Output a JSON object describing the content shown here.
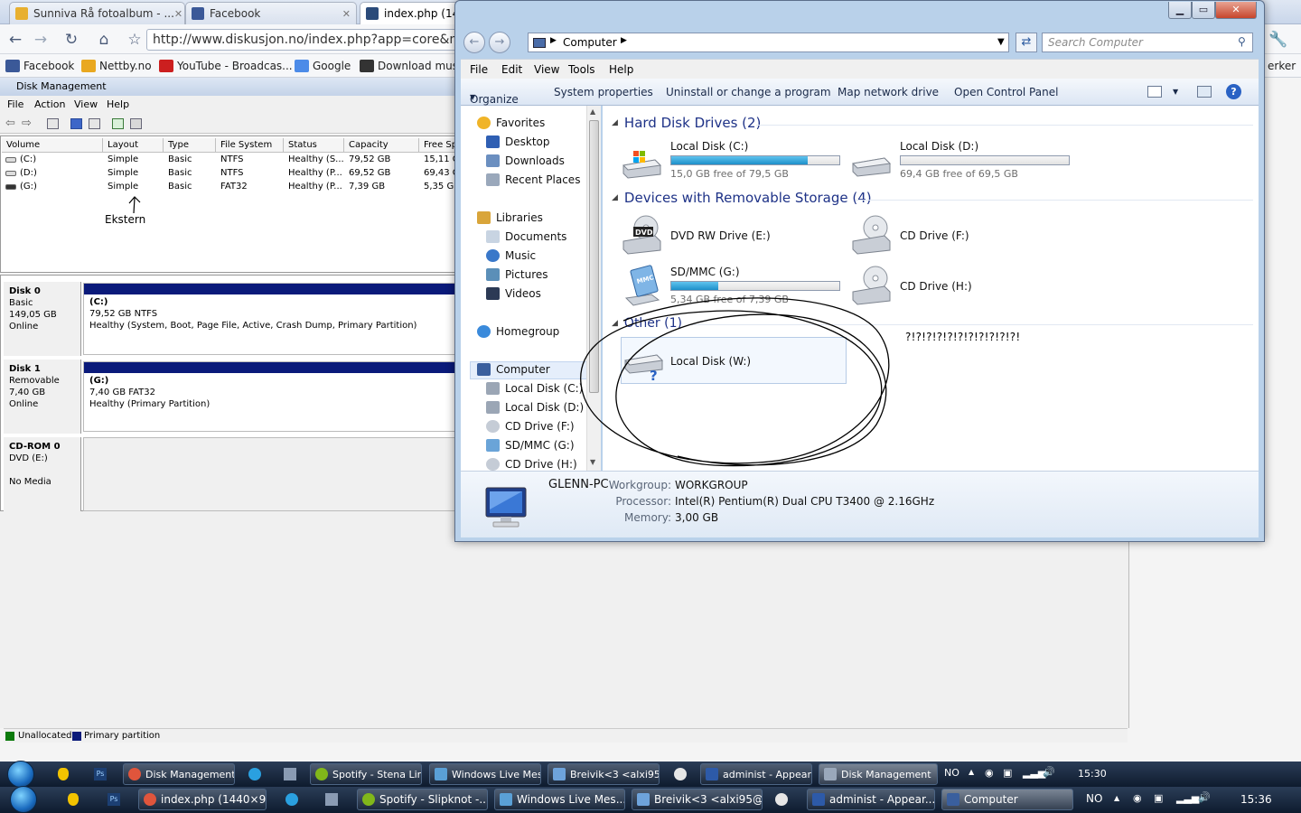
{
  "browser": {
    "tabs": [
      "Sunniva Rå fotoalbum - ...",
      "Facebook",
      "index.php (1440"
    ],
    "url": "http://www.diskusjon.no/index.php?app=core&mo",
    "bookmarks": [
      "Facebook",
      "Nettby.no",
      "YouTube - Broadcas...",
      "Google",
      "Download musi"
    ],
    "bookmarks_right": "erker"
  },
  "disk_management": {
    "title": "Disk Management",
    "menu": [
      "File",
      "Action",
      "View",
      "Help"
    ],
    "columns": [
      "Volume",
      "Layout",
      "Type",
      "File System",
      "Status",
      "Capacity",
      "Free Sp"
    ],
    "rows": [
      [
        "(C:)",
        "Simple",
        "Basic",
        "NTFS",
        "Healthy (S...",
        "79,52 GB",
        "15,11 G"
      ],
      [
        "(D:)",
        "Simple",
        "Basic",
        "NTFS",
        "Healthy (P...",
        "69,52 GB",
        "69,43 G"
      ],
      [
        "(G:)",
        "Simple",
        "Basic",
        "FAT32",
        "Healthy (P...",
        "7,39 GB",
        "5,35 GB"
      ]
    ],
    "annotation": "Ekstern",
    "disks": [
      {
        "name": "Disk 0",
        "l1": "Basic",
        "l2": "149,05 GB",
        "l3": "Online",
        "part_name": "(C:)",
        "part_size": "79,52 GB NTFS",
        "part_status": "Healthy (System, Boot, Page File, Active, Crash Dump, Primary Partition)"
      },
      {
        "name": "Disk 1",
        "l1": "Removable",
        "l2": "7,40 GB",
        "l3": "Online",
        "part_name": "(G:)",
        "part_size": "7,40 GB FAT32",
        "part_status": "Healthy (Primary Partition)"
      },
      {
        "name": "CD-ROM 0",
        "l1": "DVD (E:)",
        "l2": "",
        "l3": "No Media"
      }
    ],
    "legend": [
      "Unallocated",
      "Primary partition"
    ]
  },
  "explorer": {
    "breadcrumb": "Computer",
    "search_placeholder": "Search Computer",
    "menu": [
      "File",
      "Edit",
      "View",
      "Tools",
      "Help"
    ],
    "commands": [
      "Organize",
      "System properties",
      "Uninstall or change a program",
      "Map network drive",
      "Open Control Panel"
    ],
    "nav": {
      "favorites": "Favorites",
      "fav_items": [
        "Desktop",
        "Downloads",
        "Recent Places"
      ],
      "libraries": "Libraries",
      "lib_items": [
        "Documents",
        "Music",
        "Pictures",
        "Videos"
      ],
      "homegroup": "Homegroup",
      "computer": "Computer",
      "comp_items": [
        "Local Disk (C:)",
        "Local Disk (D:)",
        "CD Drive (F:)",
        "SD/MMC (G:)",
        "CD Drive (H:)"
      ]
    },
    "groups": {
      "hdd": "Hard Disk Drives (2)",
      "removable": "Devices with Removable Storage (4)",
      "other": "Other (1)"
    },
    "drives": {
      "c": {
        "name": "Local Disk (C:)",
        "free": "15,0 GB free of 79,5 GB",
        "used_fraction": 0.81
      },
      "d": {
        "name": "Local Disk (D:)",
        "free": "69,4 GB free of 69,5 GB",
        "used_fraction": 0.001
      },
      "e": {
        "name": "DVD RW Drive (E:)",
        "badge": "DVD"
      },
      "f": {
        "name": "CD Drive (F:)"
      },
      "g": {
        "name": "SD/MMC (G:)",
        "free": "5,34 GB free of 7,39 GB",
        "used_fraction": 0.28,
        "badge": "MMC"
      },
      "h": {
        "name": "CD Drive (H:)"
      },
      "w": {
        "name": "Local Disk (W:)"
      }
    },
    "annotation": "?!?!?!?!?!?!?!?!?!?!?!",
    "details": {
      "pc_name": "GLENN-PC",
      "workgroup_label": "Workgroup:",
      "workgroup": "WORKGROUP",
      "processor_label": "Processor:",
      "processor": "Intel(R) Pentium(R) Dual  CPU  T3400  @ 2.16GHz",
      "memory_label": "Memory:",
      "memory": "3,00 GB"
    }
  },
  "taskbar1": {
    "items": [
      "Disk Management ...",
      "Spotify - Stena Lin...",
      "Windows Live Mes...",
      "Breivik<3 <alxi95@...",
      "administ - Appear...",
      "Disk Management"
    ],
    "lang": "NO",
    "time": "15:30"
  },
  "taskbar2": {
    "items": [
      "index.php (1440×9...",
      "Spotify - Slipknot -...",
      "Windows Live Mes...",
      "Breivik<3 <alxi95@...",
      "administ - Appear...",
      "Computer"
    ],
    "lang": "NO",
    "time": "15:36"
  }
}
